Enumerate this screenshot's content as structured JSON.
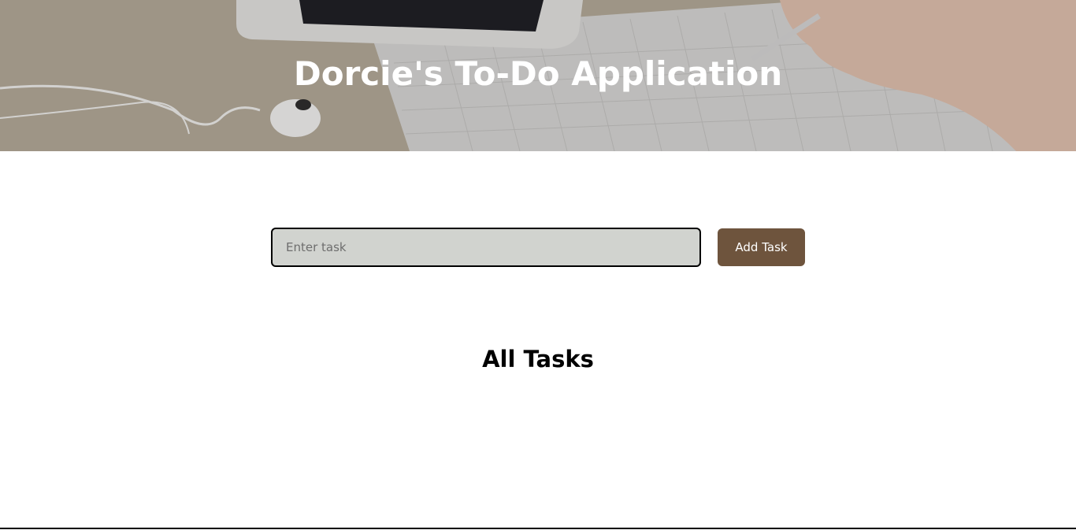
{
  "header": {
    "title": "Dorcie's To-Do Application",
    "background_image": "desk-with-tablet-earphones-and-notebook"
  },
  "task_form": {
    "input_placeholder": "Enter task",
    "input_value": "",
    "add_button_label": "Add Task"
  },
  "tasks": {
    "heading": "All Tasks",
    "items": []
  },
  "colors": {
    "button_background": "#6e543d",
    "input_background": "#d1d3cf",
    "title_text": "#ffffff"
  }
}
